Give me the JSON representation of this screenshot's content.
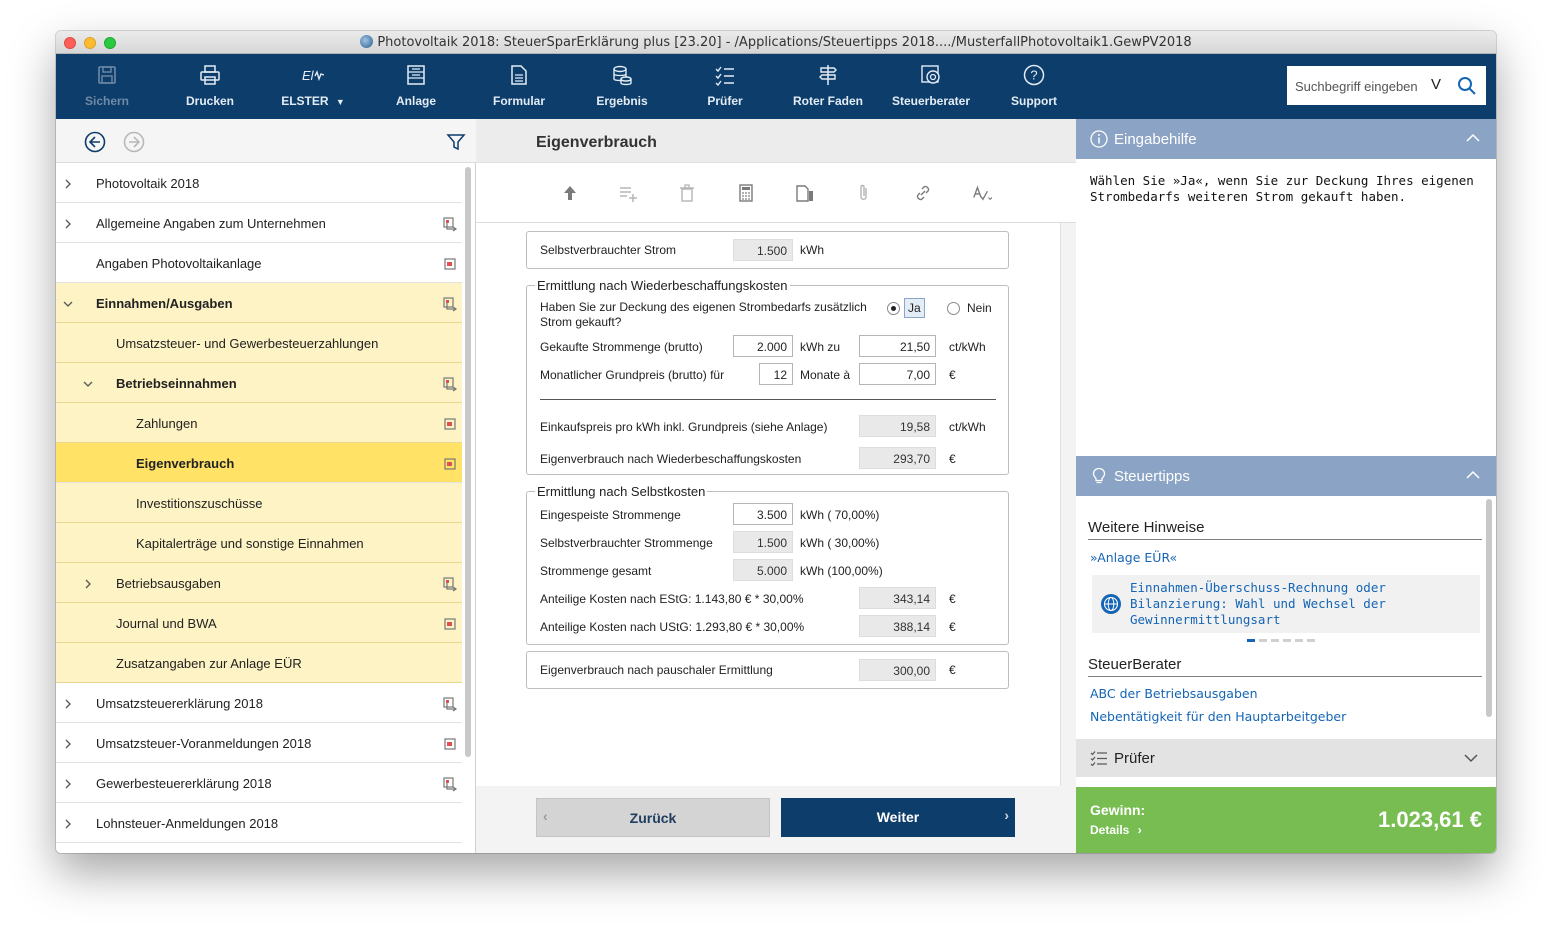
{
  "window": {
    "title": "Photovoltaik 2018: SteuerSparErklärung plus [23.20] - /Applications/Steuertipps 2018..../MusterfallPhotovoltaik1.GewPV2018"
  },
  "toolbar": {
    "items": [
      {
        "label": "Sichern",
        "icon": "save-icon",
        "disabled": true
      },
      {
        "label": "Drucken",
        "icon": "printer-icon"
      },
      {
        "label": "ELSTER",
        "icon": "elster-icon"
      },
      {
        "label": "Anlage",
        "icon": "form-stack-icon"
      },
      {
        "label": "Formular",
        "icon": "document-icon"
      },
      {
        "label": "Ergebnis",
        "icon": "coins-icon"
      },
      {
        "label": "Prüfer",
        "icon": "checklist-icon"
      },
      {
        "label": "Roter Faden",
        "icon": "signpost-icon"
      },
      {
        "label": "Steuerberater",
        "icon": "advisor-icon"
      },
      {
        "label": "Support",
        "icon": "help-icon"
      }
    ],
    "search_placeholder": "Suchbegriff eingeben",
    "search_scope": "V"
  },
  "sidebar": {
    "items": [
      {
        "label": "Photovoltaik 2018",
        "level": 0,
        "chevron": "right"
      },
      {
        "label": "Allgemeine Angaben zum Unternehmen",
        "level": 0,
        "chevron": "right",
        "action": "jump"
      },
      {
        "label": "Angaben Photovoltaikanlage",
        "level": 0,
        "action": "enter"
      },
      {
        "label": "Einnahmen/Ausgaben",
        "level": 0,
        "chevron": "down",
        "bold": true,
        "highlight": true,
        "action": "jump"
      },
      {
        "label": "Umsatzsteuer- und Gewerbesteuerzahlungen",
        "level": 1,
        "highlight": true
      },
      {
        "label": "Betriebseinnahmen",
        "level": 1,
        "chevron": "down",
        "bold": true,
        "highlight": true,
        "action": "jump"
      },
      {
        "label": "Zahlungen",
        "level": 2,
        "highlight": true,
        "action": "enter"
      },
      {
        "label": "Eigenverbrauch",
        "level": 2,
        "bold": true,
        "selected": true,
        "action": "enter"
      },
      {
        "label": "Investitionszuschüsse",
        "level": 2,
        "highlight": true
      },
      {
        "label": "Kapitalerträge und sonstige Einnahmen",
        "level": 2,
        "highlight": true
      },
      {
        "label": "Betriebsausgaben",
        "level": 1,
        "chevron": "right",
        "highlight": true,
        "action": "jump"
      },
      {
        "label": "Journal und BWA",
        "level": 1,
        "highlight": true,
        "action": "enter"
      },
      {
        "label": "Zusatzangaben zur Anlage EÜR",
        "level": 1,
        "highlight": true
      },
      {
        "label": "Umsatzsteuererklärung 2018",
        "level": 0,
        "chevron": "right",
        "action": "jump"
      },
      {
        "label": "Umsatzsteuer-Voranmeldungen 2018",
        "level": 0,
        "chevron": "right",
        "action": "enter"
      },
      {
        "label": "Gewerbesteuererklärung 2018",
        "level": 0,
        "chevron": "right",
        "action": "jump"
      },
      {
        "label": "Lohnsteuer-Anmeldungen 2018",
        "level": 0,
        "chevron": "right"
      }
    ]
  },
  "main": {
    "title": "Eigenverbrauch",
    "box1": {
      "label": "Selbstverbrauchter Strom",
      "value": "1.500",
      "unit": "kWh"
    },
    "box2": {
      "legend": "Ermittlung nach Wiederbeschaffungskosten",
      "question_line1": "Haben Sie zur Deckung des eigenen Strombedarfs zusätzlich",
      "question_line2": "Strom gekauft?",
      "yes": "Ja",
      "no": "Nein",
      "amount_label": "Gekaufte Strommenge (brutto)",
      "amount_value": "2.000",
      "amount_unit": "kWh zu",
      "price_value": "21,50",
      "price_unit": "ct/kWh",
      "base_label": "Monatlicher Grundpreis (brutto) für",
      "months_value": "12",
      "months_unit": "Monate à",
      "base_value": "7,00",
      "euro": "€",
      "purchase_label": "Einkaufspreis pro kWh inkl. Grundpreis (siehe Anlage)",
      "purchase_value": "19,58",
      "purchase_unit": "ct/kWh",
      "result_label": "Eigenverbrauch nach Wiederbeschaffungskosten",
      "result_value": "293,70",
      "result_unit": "€"
    },
    "box3": {
      "legend": "Ermittlung nach Selbstkosten",
      "fed_label": "Eingespeiste Strommenge",
      "fed_value": "3.500",
      "fed_unit": "kWh ( 70,00%)",
      "self_label": "Selbstverbrauchter Strommenge",
      "self_value": "1.500",
      "self_unit": "kWh ( 30,00%)",
      "total_label": "Strommenge gesamt",
      "total_value": "5.000",
      "total_unit": "kWh (100,00%)",
      "estg_label": "Anteilige Kosten nach EStG: 1.143,80 € * 30,00%",
      "estg_value": "343,14",
      "estg_unit": "€",
      "ustg_label": "Anteilige Kosten nach UStG: 1.293,80 € * 30,00%",
      "ustg_value": "388,14",
      "ustg_unit": "€"
    },
    "box4": {
      "label": "Eigenverbrauch nach pauschaler Ermittlung",
      "value": "300,00",
      "unit": "€"
    },
    "back_label": "Zurück",
    "next_label": "Weiter"
  },
  "right": {
    "help_title": "Eingabehilfe",
    "help_text": "Wählen Sie »Ja«, wenn Sie zur Deckung Ihres eigenen Strombedarfs weiteren Strom gekauft haben.",
    "tips_title": "Steuertipps",
    "hints_heading": "Weitere Hinweise",
    "hints_link": "»Anlage EÜR«",
    "card_text": "Einnahmen-Überschuss-Rechnung oder Bilanzierung: Wahl und Wechsel der Gewinnermittlungsart",
    "advisor_heading": "SteuerBerater",
    "advisor_links": [
      "ABC der Betriebsausgaben",
      "Nebentätigkeit für den Hauptarbeitgeber"
    ],
    "pruefer_title": "Prüfer",
    "profit_label": "Gewinn:",
    "details_label": "Details",
    "profit_value": "1.023,61 €"
  },
  "colors": {
    "toolbar": "#0d3d6a",
    "highlight": "#fdf3c4",
    "selected": "#ffe266",
    "panel": "#8ba3c4",
    "profit": "#78bd52"
  }
}
